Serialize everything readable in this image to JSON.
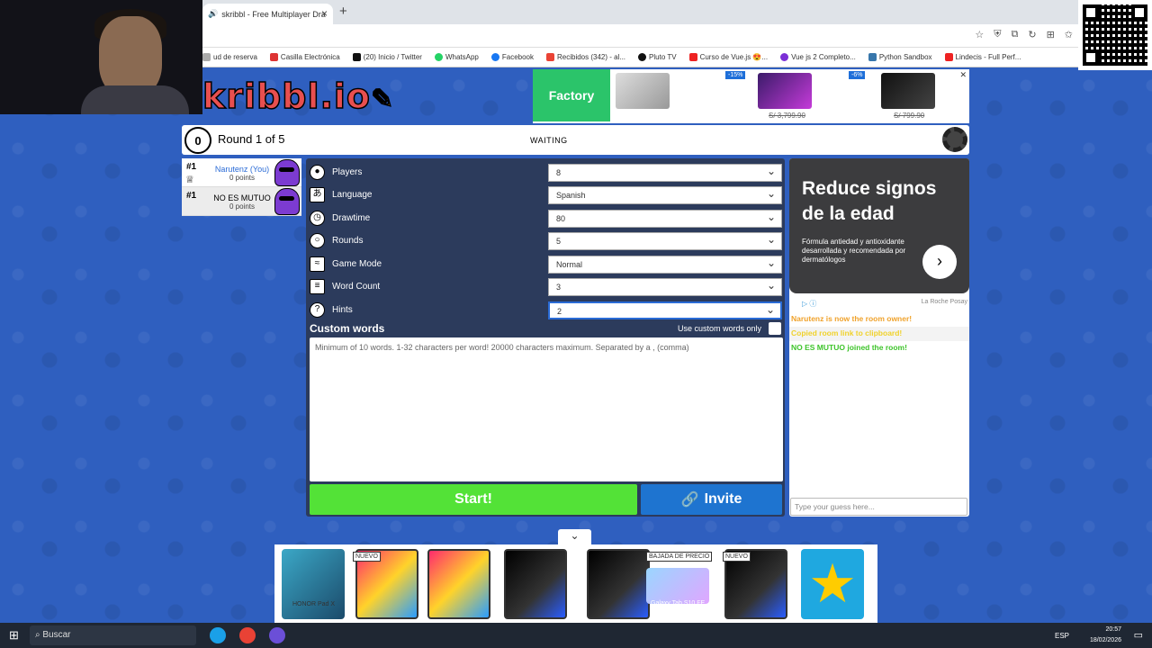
{
  "browser": {
    "tab_title": "skribbl - Free Multiplayer Dra",
    "tab_close": "×",
    "new_tab": "+",
    "address_hint": "",
    "bookmarks": [
      {
        "label": "ud de reserva",
        "color": "#aaaaaa"
      },
      {
        "label": "Casilla Electrónica",
        "color": "#d33"
      },
      {
        "label": "(20) Inicio / Twitter",
        "color": "#111"
      },
      {
        "label": "WhatsApp",
        "color": "#25d366"
      },
      {
        "label": "Facebook",
        "color": "#1877f2"
      },
      {
        "label": "Recibidos (342) - al...",
        "color": "#ea4335"
      },
      {
        "label": "Pluto TV",
        "color": "#111"
      },
      {
        "label": "Curso de Vue.js 😍...",
        "color": "#e22"
      },
      {
        "label": "Vue js 2 Completo...",
        "color": "#7b2fd6"
      },
      {
        "label": "Python Sandbox",
        "color": "#3776ab"
      },
      {
        "label": "Lindecis - Full Perf...",
        "color": "#e22"
      }
    ]
  },
  "logo": {
    "text": "kribbl.io"
  },
  "ad_top": {
    "brand": "Factory",
    "badge1": "-15%",
    "badge2": "-6%",
    "price1": "S/ 3,799.90",
    "price2": "S/ 799.90",
    "close": "✕"
  },
  "game": {
    "timer": "0",
    "round": "Round 1 of 5",
    "status": "WAITING"
  },
  "players": [
    {
      "rank": "#1",
      "name": "Narutenz (You)",
      "points": "0 points",
      "crown": "♕"
    },
    {
      "rank": "#1",
      "name": "NO ES MUTUO",
      "points": "0 points"
    }
  ],
  "settings": [
    {
      "label": "Players",
      "value": "8",
      "icon": "user-icon"
    },
    {
      "label": "Language",
      "value": "Spanish",
      "icon": "language-icon"
    },
    {
      "label": "Drawtime",
      "value": "80",
      "icon": "clock-icon"
    },
    {
      "label": "Rounds",
      "value": "5",
      "icon": "rounds-icon"
    },
    {
      "label": "Game Mode",
      "value": "Normal",
      "icon": "gamemode-icon"
    },
    {
      "label": "Word Count",
      "value": "3",
      "icon": "wordcount-icon"
    },
    {
      "label": "Hints",
      "value": "2",
      "icon": "hint-icon"
    }
  ],
  "custom_words": {
    "title": "Custom words",
    "use_label": "Use custom words only",
    "placeholder": "Minimum of 10 words. 1-32 characters per word! 20000 characters maximum. Separated by a , (comma)"
  },
  "buttons": {
    "start": "Start!",
    "invite": "Invite"
  },
  "ad_right": {
    "headline": "Reduce signos de la edad",
    "body": "Fórmula antiedad y antioxidante desarrollada y recomendada por dermatólogos",
    "brand": "La Roche Posay",
    "info": "▷ ⓘ"
  },
  "chat": {
    "messages": [
      {
        "text": "Narutenz is now the room owner!",
        "color": "#f0a22b"
      },
      {
        "text": "Copied room link to clipboard!",
        "color": "#f0d22b"
      },
      {
        "text": "NO ES MUTUO joined the room!",
        "color": "#3ec42b"
      }
    ],
    "placeholder": "Type your guess here..."
  },
  "ad_bottom": {
    "honor": "HONOR Pad X",
    "tag_new": "NUEVO",
    "tag_sale": "BAJADA DE PRECIO",
    "galaxy": "Galaxy Tab S10 FE",
    "tag_new2": "NUEVO",
    "chevron": "⌄"
  },
  "taskbar": {
    "search": "Buscar",
    "lang": "ESP",
    "time": "20:57",
    "date": "18/02/2026"
  }
}
